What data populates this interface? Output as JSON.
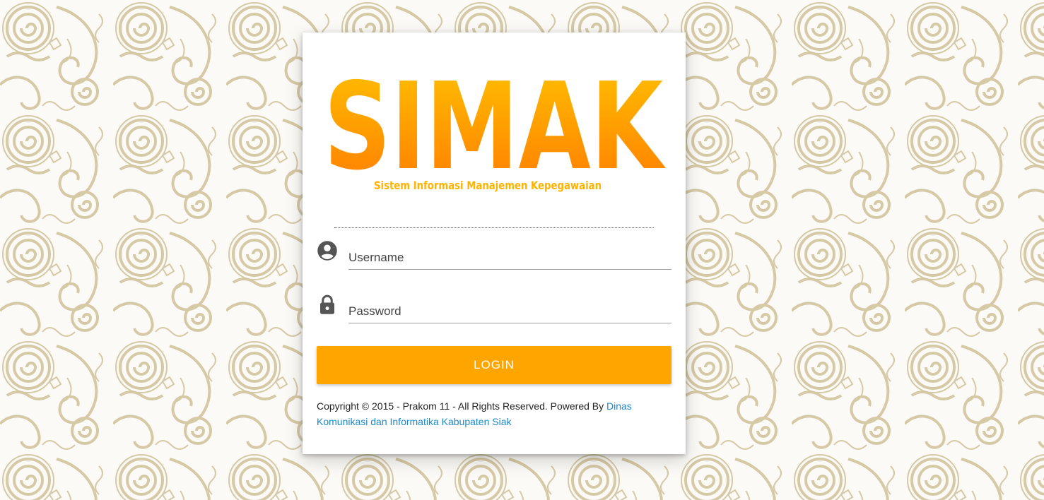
{
  "logo": {
    "title": "SIMAK",
    "subtitle": "Sistem Informasi Manajemen Kepegawaian"
  },
  "form": {
    "username_placeholder": "Username",
    "password_placeholder": "Password",
    "login_label": "LOGIN",
    "username_icon": "account-circle-icon",
    "password_icon": "lock-icon"
  },
  "footer": {
    "copyright_text": "Copyright © 2015 - Prakom 11 - All Rights Reserved. Powered By ",
    "link_text": "Dinas Komunikasi dan Informatika Kabupaten Siak"
  },
  "colors": {
    "accent": "#ffa500",
    "logo_gradient_top": "#ffc200",
    "logo_gradient_bottom": "#ff7a00",
    "link": "#1e88c8",
    "background_pattern": "#d6c9a6"
  }
}
